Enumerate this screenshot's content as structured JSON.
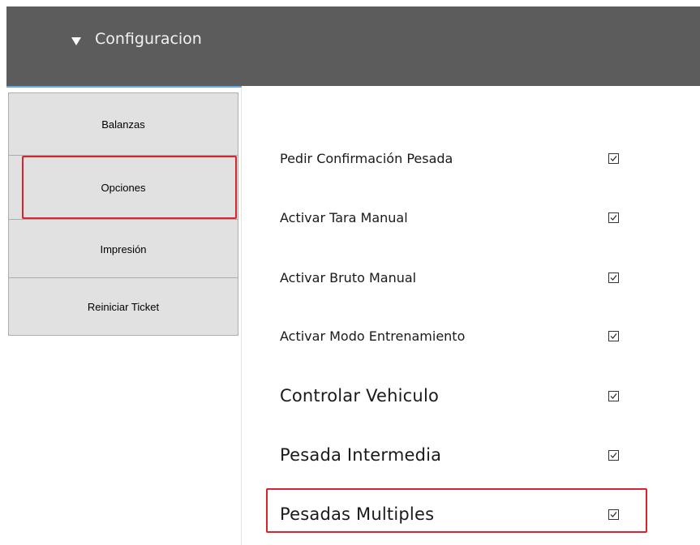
{
  "header": {
    "title": "Configuracion",
    "toggle_icon": "triangle-down-icon"
  },
  "sidebar": {
    "items": [
      {
        "label": "Balanzas"
      },
      {
        "label": "Opciones",
        "highlighted": true
      },
      {
        "label": "Impresión"
      },
      {
        "label": "Reiniciar Ticket"
      }
    ]
  },
  "options": [
    {
      "label": "Pedir Confirmación Pesada",
      "checked": true
    },
    {
      "label": "Activar Tara Manual",
      "checked": true
    },
    {
      "label": "Activar Bruto Manual",
      "checked": true
    },
    {
      "label": "Activar Modo Entrenamiento",
      "checked": true
    },
    {
      "label": "Controlar Vehiculo",
      "checked": true
    },
    {
      "label": "Pesada Intermedia",
      "checked": true
    },
    {
      "label": "Pesadas Multiples",
      "checked": true,
      "highlighted": true
    }
  ],
  "colors": {
    "header_bg": "#5c5c5c",
    "highlight": "#d9232d",
    "accent": "#6aa9dd"
  }
}
